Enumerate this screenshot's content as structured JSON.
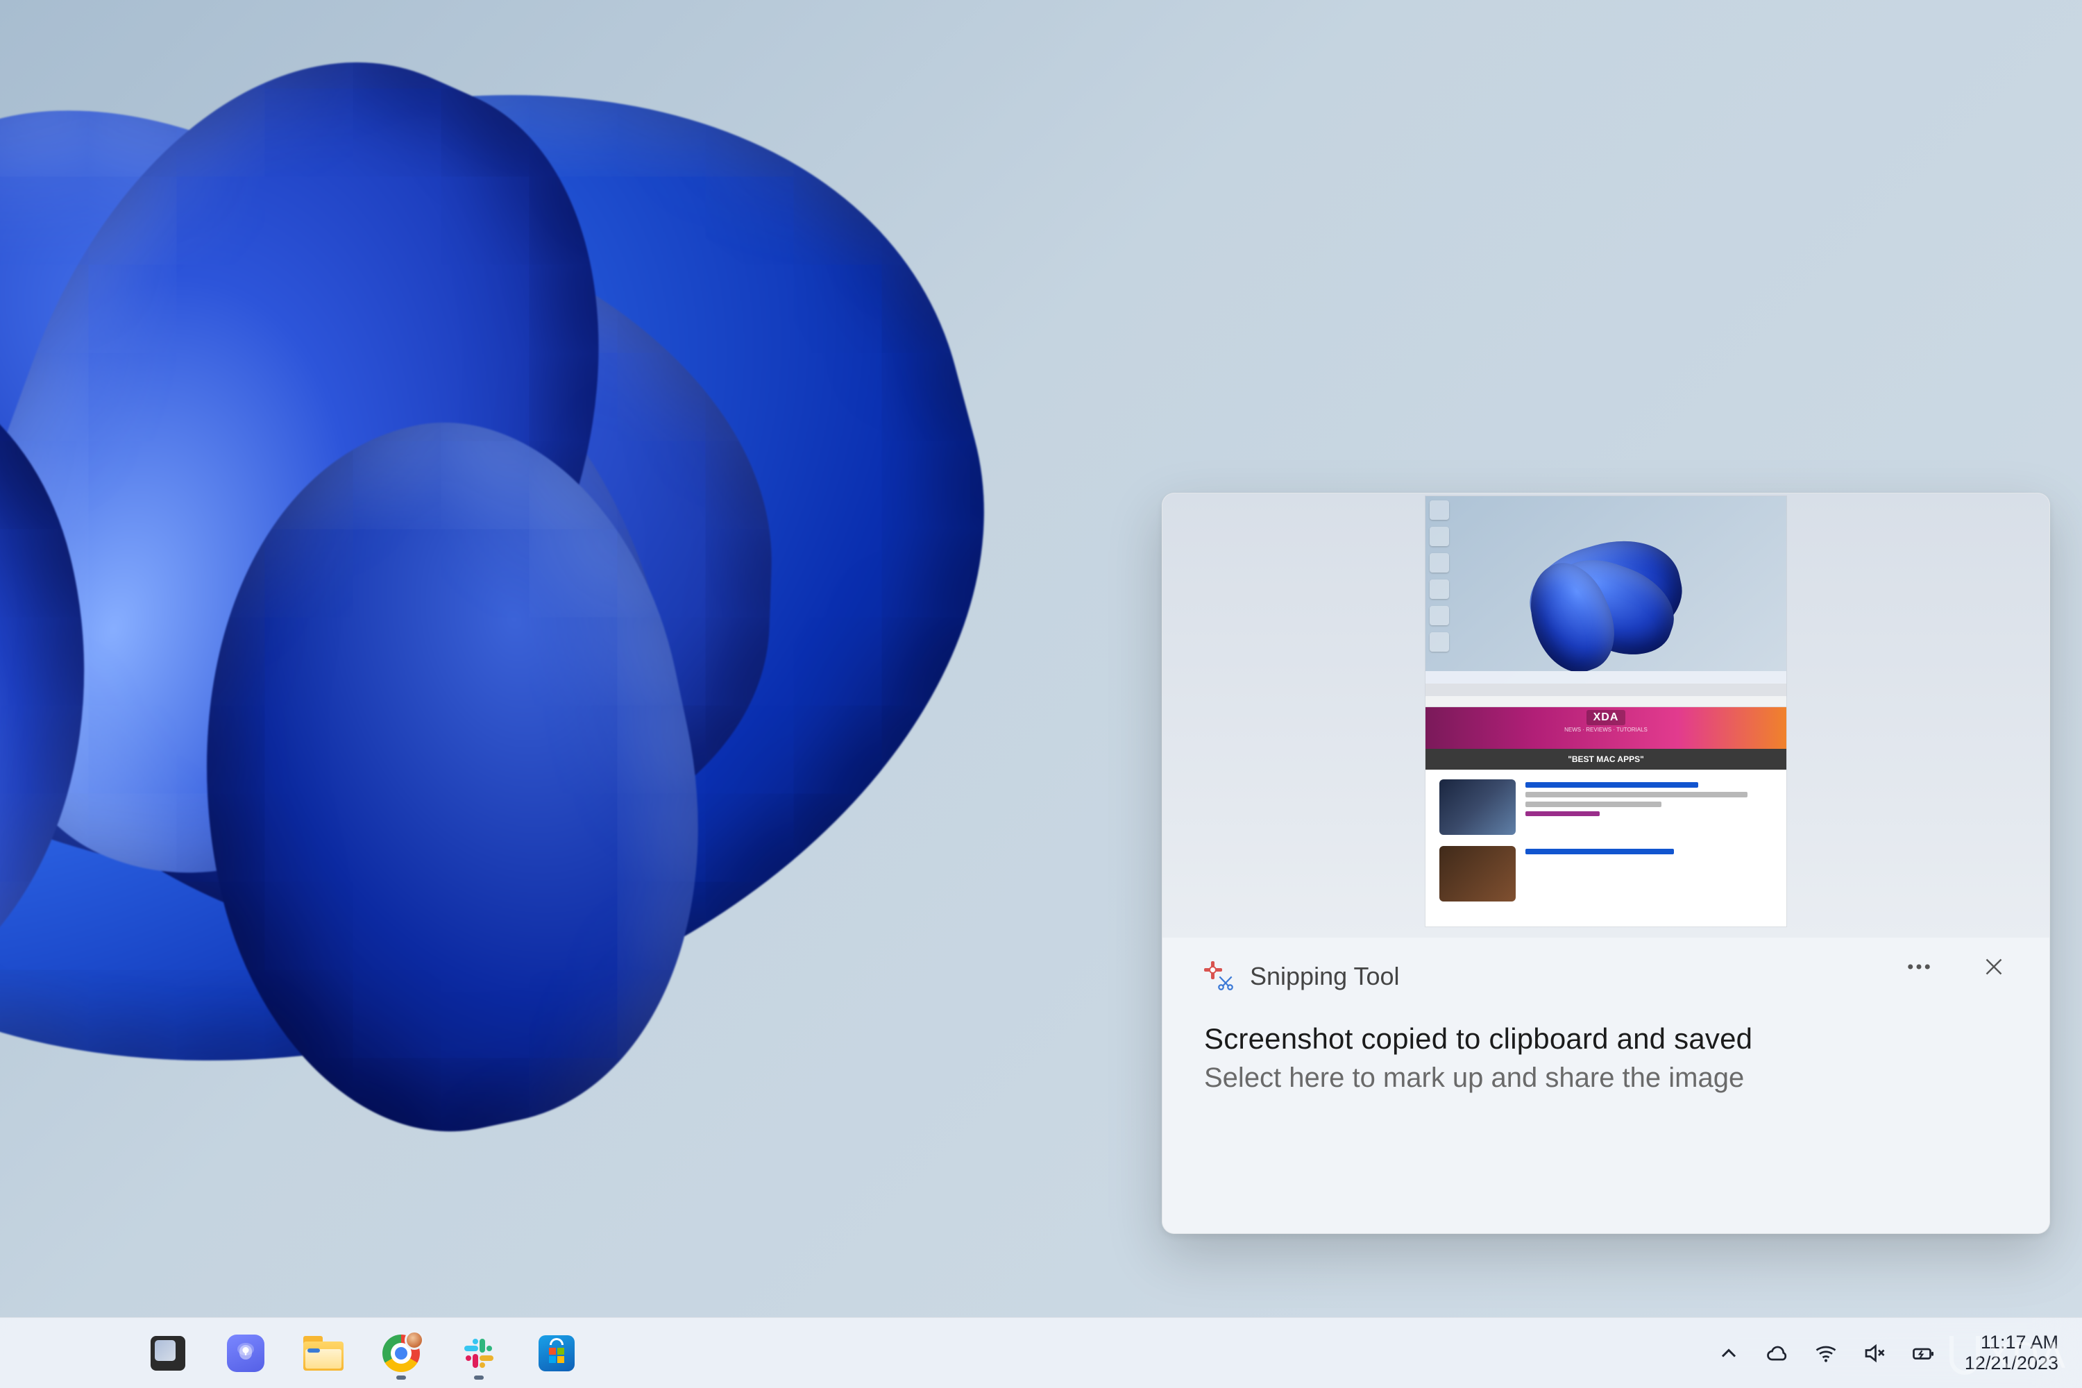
{
  "notification": {
    "app_name": "Snipping Tool",
    "title": "Screenshot copied to clipboard and saved",
    "subtitle": "Select here to mark up and share the image",
    "more_icon": "more-icon",
    "close_icon": "close-icon",
    "preview": {
      "site_logo": "XDA",
      "site_tag": "NEWS · REVIEWS · TUTORIALS",
      "hero_banner": "\"BEST MAC APPS\""
    }
  },
  "taskbar": {
    "apps": [
      {
        "name": "task-view",
        "running": false
      },
      {
        "name": "microsoft-teams",
        "running": false
      },
      {
        "name": "file-explorer",
        "running": false
      },
      {
        "name": "google-chrome",
        "running": true
      },
      {
        "name": "slack",
        "running": true
      },
      {
        "name": "microsoft-store",
        "running": false
      }
    ]
  },
  "tray": {
    "overflow_icon": "chevron-up-icon",
    "onedrive_icon": "cloud-icon",
    "wifi_icon": "wifi-icon",
    "volume_icon": "volume-muted-icon",
    "battery_icon": "battery-charging-icon",
    "time": "11:17 AM",
    "date": "12/21/2023"
  },
  "watermark": "XDA"
}
